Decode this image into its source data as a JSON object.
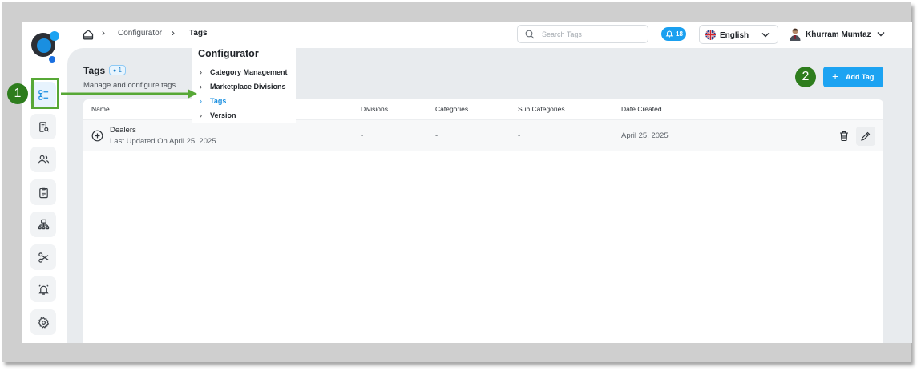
{
  "breadcrumb": {
    "level1": "Configurator",
    "current": "Tags"
  },
  "search": {
    "placeholder": "Search Tags"
  },
  "notifications": {
    "count": "18"
  },
  "language": {
    "selected": "English"
  },
  "user": {
    "name": "Khurram Mumtaz"
  },
  "page": {
    "title": "Tags",
    "count": "1",
    "subtitle": "Manage and configure tags"
  },
  "add_button": {
    "label": "Add Tag"
  },
  "table": {
    "headers": [
      "Name",
      "Divisions",
      "Categories",
      "Sub Categories",
      "Date Created"
    ],
    "rows": [
      {
        "name": "Dealers",
        "updated": "Last Updated On April 25, 2025",
        "divisions": "-",
        "categories": "-",
        "sub_categories": "-",
        "date_created": "April 25, 2025"
      }
    ]
  },
  "dropdown": {
    "title": "Configurator",
    "items": [
      "Category Management",
      "Marketplace Divisions",
      "Tags",
      "Version"
    ],
    "selected": "Tags"
  },
  "annotations": {
    "step1": "1",
    "step2": "2"
  },
  "colors": {
    "accent": "#1ca3f2",
    "annotation": "#2e7d1d",
    "annotation_box": "#57a836"
  }
}
